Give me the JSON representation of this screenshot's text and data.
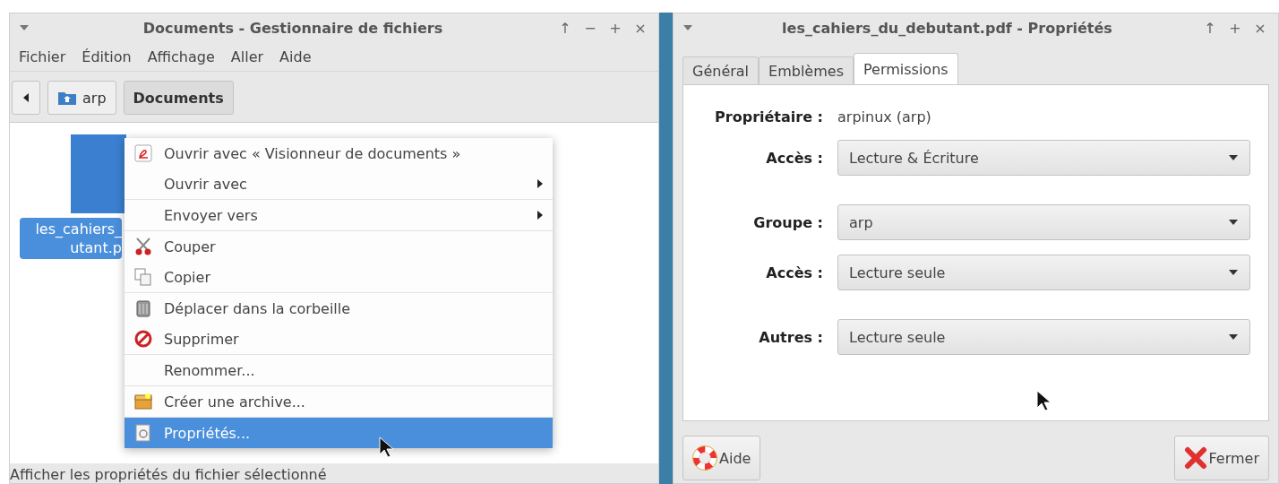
{
  "file_manager": {
    "title": "Documents - Gestionnaire de fichiers",
    "controls": [
      "↑",
      "−",
      "+",
      "×"
    ],
    "menubar": [
      "Fichier",
      "Édition",
      "Affichage",
      "Aller",
      "Aide"
    ],
    "path_bar": [
      {
        "label": "arp",
        "selected": false
      },
      {
        "label": "Documents",
        "selected": true
      }
    ],
    "file": {
      "name_lines": [
        "les_cahiers_",
        "utant.p"
      ],
      "selected": true
    },
    "context_menu": {
      "sections": [
        [
          {
            "label": "Ouvrir avec « Visionneur de documents »",
            "submenu": false,
            "selected": false
          },
          {
            "label": "Ouvrir avec",
            "submenu": true,
            "selected": false
          }
        ],
        [
          {
            "label": "Envoyer vers",
            "submenu": true,
            "selected": false
          }
        ],
        [
          {
            "label": "Couper",
            "submenu": false,
            "selected": false
          },
          {
            "label": "Copier",
            "submenu": false,
            "selected": false
          }
        ],
        [
          {
            "label": "Déplacer dans la corbeille",
            "submenu": false,
            "selected": false
          },
          {
            "label": "Supprimer",
            "submenu": false,
            "selected": false
          }
        ],
        [
          {
            "label": "Renommer...",
            "submenu": false,
            "selected": false
          }
        ],
        [
          {
            "label": "Créer une archive...",
            "submenu": false,
            "selected": false
          }
        ],
        [
          {
            "label": "Propriétés...",
            "submenu": false,
            "selected": true
          }
        ]
      ]
    },
    "status_bar": "Afficher les propriétés du fichier sélectionné"
  },
  "properties": {
    "title": "les_cahiers_du_debutant.pdf - Propriétés",
    "controls": [
      "↑",
      "+",
      "×"
    ],
    "tabs": [
      {
        "label": "Général",
        "selected": false
      },
      {
        "label": "Emblèmes",
        "selected": false
      },
      {
        "label": "Permissions",
        "selected": true
      }
    ],
    "sections": [
      [
        {
          "kind": "text",
          "label": "Propriétaire :",
          "value": "arpinux (arp)"
        },
        {
          "kind": "combo",
          "label": "Accès :",
          "value": "Lecture & Écriture"
        }
      ],
      [
        {
          "kind": "combo",
          "label": "Groupe :",
          "value": "arp"
        },
        {
          "kind": "combo",
          "label": "Accès :",
          "value": "Lecture seule"
        }
      ],
      [
        {
          "kind": "combo",
          "label": "Autres :",
          "value": "Lecture seule"
        }
      ]
    ],
    "buttons": [
      "Aide",
      "Fermer"
    ]
  }
}
